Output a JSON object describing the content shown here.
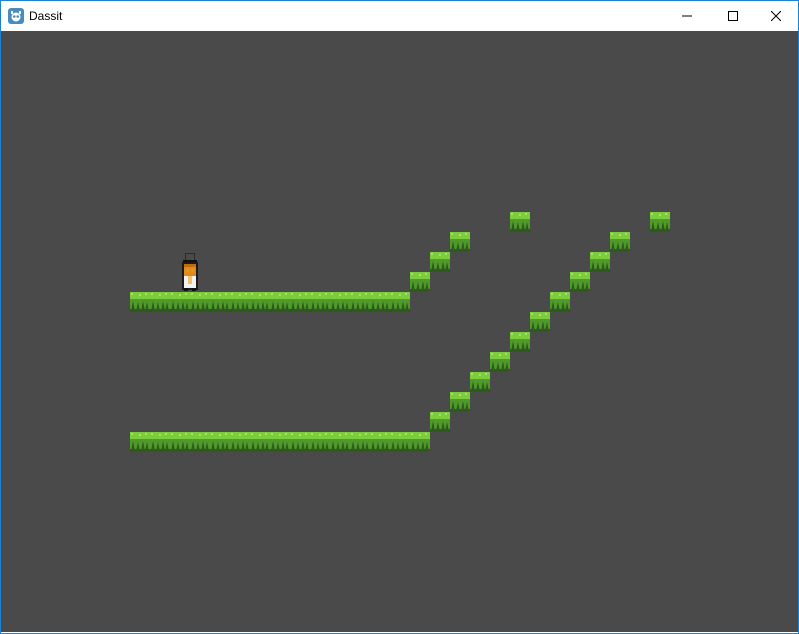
{
  "window": {
    "title": "Dassit",
    "app_icon": "godot-icon",
    "controls": {
      "minimize": "minimize-icon",
      "maximize": "maximize-icon",
      "close": "close-icon"
    }
  },
  "game": {
    "background_color": "#4a4a4a",
    "grass_top_color": "#7ccd3c",
    "grass_mid_color": "#4f9a2a",
    "grass_dark_color": "#2f5a1d"
  }
}
